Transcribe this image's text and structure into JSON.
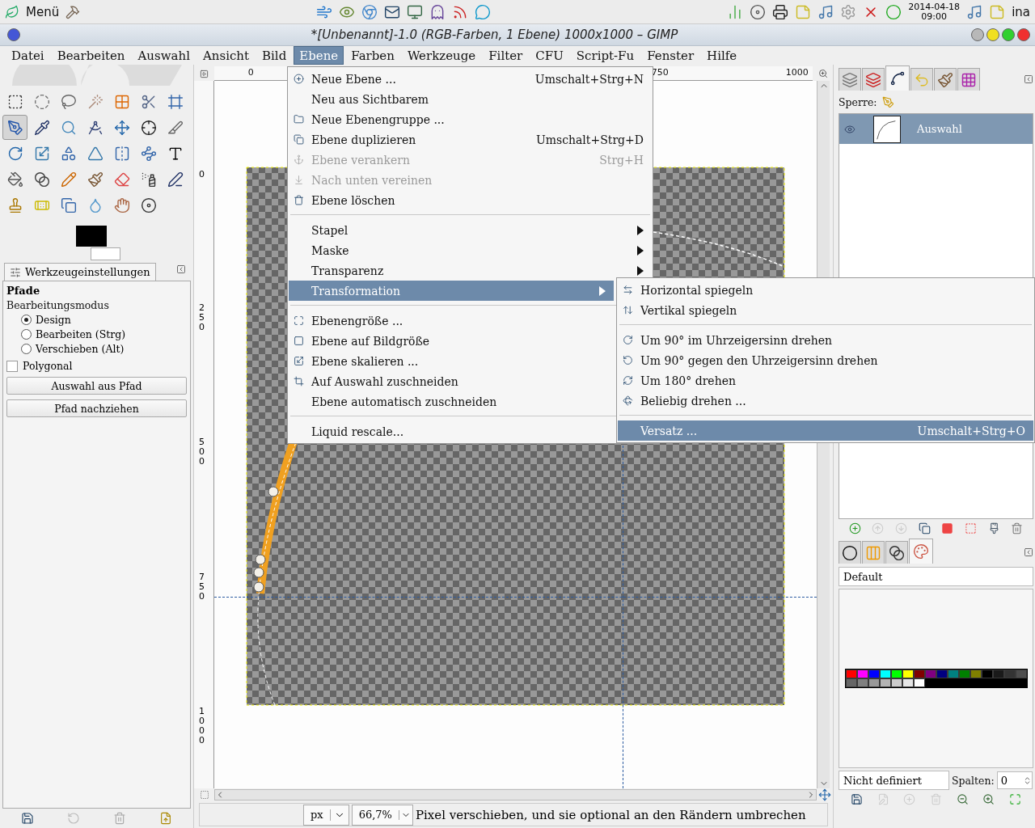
{
  "top_panel": {
    "menu_label": "Menü",
    "date": "2014-04-18",
    "time": "09:00",
    "user": "ina"
  },
  "window": {
    "title": "*[Unbenannt]-1.0 (RGB-Farben, 1 Ebene) 1000x1000 – GIMP"
  },
  "menubar": [
    {
      "label": "Datei",
      "selected": false
    },
    {
      "label": "Bearbeiten",
      "selected": false
    },
    {
      "label": "Auswahl",
      "selected": false
    },
    {
      "label": "Ansicht",
      "selected": false
    },
    {
      "label": "Bild",
      "selected": false
    },
    {
      "label": "Ebene",
      "selected": true
    },
    {
      "label": "Farben",
      "selected": false
    },
    {
      "label": "Werkzeuge",
      "selected": false
    },
    {
      "label": "Filter",
      "selected": false
    },
    {
      "label": "CFU",
      "selected": false
    },
    {
      "label": "Script-Fu",
      "selected": false
    },
    {
      "label": "Fenster",
      "selected": false
    },
    {
      "label": "Hilfe",
      "selected": false
    }
  ],
  "layer_menu": [
    {
      "kind": "item",
      "label": "Neue Ebene ...",
      "shortcut": "Umschalt+Strg+N",
      "disabled": false,
      "selected": false
    },
    {
      "kind": "item",
      "label": "Neu aus Sichtbarem",
      "disabled": false,
      "selected": false
    },
    {
      "kind": "item",
      "label": "Neue Ebenengruppe ...",
      "disabled": false,
      "selected": false
    },
    {
      "kind": "item",
      "label": "Ebene duplizieren",
      "shortcut": "Umschalt+Strg+D",
      "disabled": false,
      "selected": false
    },
    {
      "kind": "item",
      "label": "Ebene verankern",
      "shortcut": "Strg+H",
      "disabled": true,
      "selected": false
    },
    {
      "kind": "item",
      "label": "Nach unten vereinen",
      "disabled": true,
      "selected": false
    },
    {
      "kind": "item",
      "label": "Ebene löschen",
      "disabled": false,
      "selected": false
    },
    {
      "kind": "separator"
    },
    {
      "kind": "submenu",
      "label": "Stapel",
      "disabled": false,
      "selected": false
    },
    {
      "kind": "submenu",
      "label": "Maske",
      "disabled": false,
      "selected": false
    },
    {
      "kind": "submenu",
      "label": "Transparenz",
      "disabled": false,
      "selected": false
    },
    {
      "kind": "submenu",
      "label": "Transformation",
      "disabled": false,
      "selected": true
    },
    {
      "kind": "separator"
    },
    {
      "kind": "item",
      "label": "Ebenengröße ...",
      "disabled": false,
      "selected": false
    },
    {
      "kind": "item",
      "label": "Ebene auf Bildgröße",
      "disabled": false,
      "selected": false
    },
    {
      "kind": "item",
      "label": "Ebene skalieren ...",
      "disabled": false,
      "selected": false
    },
    {
      "kind": "item",
      "label": "Auf Auswahl zuschneiden",
      "disabled": false,
      "selected": false
    },
    {
      "kind": "item",
      "label": "Ebene automatisch zuschneiden",
      "disabled": false,
      "selected": false
    },
    {
      "kind": "separator"
    },
    {
      "kind": "item",
      "label": "Liquid rescale...",
      "disabled": false,
      "selected": false
    }
  ],
  "transform_menu": [
    {
      "kind": "item",
      "label": "Horizontal spiegeln",
      "disabled": false,
      "selected": false
    },
    {
      "kind": "item",
      "label": "Vertikal spiegeln",
      "disabled": false,
      "selected": false
    },
    {
      "kind": "separator"
    },
    {
      "kind": "item",
      "label": "Um 90° im Uhrzeigersinn drehen",
      "disabled": false,
      "selected": false
    },
    {
      "kind": "item",
      "label": "Um 90° gegen den Uhrzeigersinn drehen",
      "disabled": false,
      "selected": false
    },
    {
      "kind": "item",
      "label": "Um 180° drehen",
      "disabled": false,
      "selected": false
    },
    {
      "kind": "item",
      "label": "Beliebig drehen ...",
      "disabled": false,
      "selected": false
    },
    {
      "kind": "separator"
    },
    {
      "kind": "item",
      "label": "Versatz ...",
      "shortcut": "Umschalt+Strg+O",
      "disabled": false,
      "selected": true
    }
  ],
  "toolbox": [
    {
      "selected": false
    },
    {
      "selected": false
    },
    {
      "selected": false
    },
    {
      "selected": false
    },
    {
      "selected": false
    },
    {
      "selected": false
    },
    {
      "selected": false
    },
    {
      "selected": true
    },
    {
      "selected": false
    },
    {
      "selected": false
    },
    {
      "selected": false
    },
    {
      "selected": false
    },
    {
      "selected": false
    },
    {
      "selected": false
    },
    {
      "selected": false
    },
    {
      "selected": false
    },
    {
      "selected": false
    },
    {
      "selected": false
    },
    {
      "selected": false
    },
    {
      "selected": false
    },
    {
      "selected": false
    },
    {
      "selected": false
    },
    {
      "selected": false
    },
    {
      "selected": false
    },
    {
      "selected": false
    },
    {
      "selected": false
    },
    {
      "selected": false
    },
    {
      "selected": false
    },
    {
      "selected": false
    },
    {
      "selected": false
    },
    {
      "selected": false
    },
    {
      "selected": false
    },
    {
      "selected": false
    },
    {
      "selected": false
    }
  ],
  "tool_options": {
    "tab": "Werkzeugeinstellungen",
    "title": "Pfade",
    "mode_label": "Bearbeitungsmodus",
    "modes": [
      {
        "label": "Design",
        "selected": true
      },
      {
        "label": "Bearbeiten (Strg)",
        "selected": false
      },
      {
        "label": "Verschieben (Alt)",
        "selected": false
      }
    ],
    "polygonal": {
      "label": "Polygonal",
      "checked": false
    },
    "buttons": [
      "Auswahl aus Pfad",
      "Pfad nachziehen"
    ]
  },
  "canvas": {
    "top_ruler_labels": [
      "0",
      "750",
      "1000"
    ],
    "left_ruler_labels": [
      "0",
      "250",
      "500",
      "750",
      "1000"
    ]
  },
  "status_bar": {
    "unit": "px",
    "zoom": "66,7%",
    "message": "Pixel verschieben, und sie optional an den Rändern umbrechen"
  },
  "paths_dock": {
    "tabs": [
      {
        "selected": false
      },
      {
        "selected": false
      },
      {
        "selected": true
      },
      {
        "selected": false
      },
      {
        "selected": false
      },
      {
        "selected": false
      }
    ],
    "lock_label": "Sperre:",
    "paths": [
      {
        "name": "Auswahl",
        "selected": true,
        "visible": true
      }
    ]
  },
  "palette_dock": {
    "tabs": [
      {
        "selected": false
      },
      {
        "selected": false
      },
      {
        "selected": false
      },
      {
        "selected": true
      }
    ],
    "palette_name": "Default",
    "swatches": [
      {
        "color": "#ff0000"
      },
      {
        "color": "#ff00ff"
      },
      {
        "color": "#0000ff"
      },
      {
        "color": "#00ffff"
      },
      {
        "color": "#00ff00"
      },
      {
        "color": "#ffff00"
      },
      {
        "color": "#800000"
      },
      {
        "color": "#800080"
      },
      {
        "color": "#000080"
      },
      {
        "color": "#008080"
      },
      {
        "color": "#008000"
      },
      {
        "color": "#808000"
      },
      {
        "color": "#000000"
      },
      {
        "color": "#1a1a1a"
      },
      {
        "color": "#333333"
      },
      {
        "color": "#4d4d4d"
      },
      {
        "color": "#666666"
      },
      {
        "color": "#808080"
      },
      {
        "color": "#999999"
      },
      {
        "color": "#b3b3b3"
      },
      {
        "color": "#cccccc"
      },
      {
        "color": "#e6e6e6"
      },
      {
        "color": "#ffffff"
      }
    ],
    "name_field": "Nicht definiert",
    "columns_label": "Spalten:",
    "columns_value": "0"
  }
}
